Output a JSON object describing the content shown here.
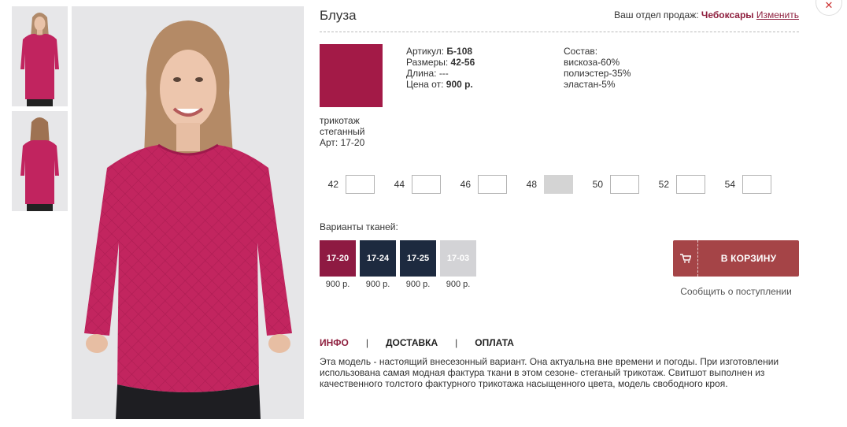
{
  "product": {
    "title": "Блуза",
    "article_label": "Артикул:",
    "article": "Б-108",
    "sizes_label": "Размеры:",
    "sizes_range": "42-56",
    "length_label": "Длина:",
    "length": "---",
    "price_label": "Цена от:",
    "price": "900 р."
  },
  "department": {
    "label": "Ваш отдел продаж:",
    "city": "Чебоксары",
    "change_label": "Изменить"
  },
  "fabric": {
    "caption_line1": "трикотаж",
    "caption_line2": "стеганный",
    "caption_line3": "Арт: 17-20",
    "color": "#a31a47"
  },
  "composition": {
    "title": "Состав:",
    "items": [
      "вискоза-60%",
      "полиэстер-35%",
      "эластан-5%"
    ]
  },
  "sizes": [
    {
      "label": "42",
      "available": true
    },
    {
      "label": "44",
      "available": true
    },
    {
      "label": "46",
      "available": true
    },
    {
      "label": "48",
      "available": false
    },
    {
      "label": "50",
      "available": true
    },
    {
      "label": "52",
      "available": true
    },
    {
      "label": "54",
      "available": true
    }
  ],
  "variants": {
    "label": "Варианты тканей:",
    "items": [
      {
        "code": "17-20",
        "price": "900 р.",
        "color": "#8e1a42"
      },
      {
        "code": "17-24",
        "price": "900 р.",
        "color": "#1d2a3f"
      },
      {
        "code": "17-25",
        "price": "900 р.",
        "color": "#1d2a3f"
      },
      {
        "code": "17-03",
        "price": "900 р.",
        "color": "#d3d3d6"
      }
    ]
  },
  "cart": {
    "button_label": "В КОРЗИНУ",
    "notify_label": "Сообщить о поступлении",
    "color": "#a54447"
  },
  "tabs": [
    {
      "label": "ИНФО",
      "active": true
    },
    {
      "label": "ДОСТАВКА",
      "active": false
    },
    {
      "label": "ОПЛАТА",
      "active": false
    }
  ],
  "tab_separator": "|",
  "description": "Эта модель - настоящий внесезонный вариант. Она актуальна вне времени и погоды. При изготовлении использована самая модная фактура ткани в этом сезоне- стеганый трикотаж. Свитшот выполнен из качественного толстого фактурного трикотажа насыщенного цвета, модель свободного кроя.",
  "accent_color": "#8e1f3e",
  "close_icon": "close-icon"
}
